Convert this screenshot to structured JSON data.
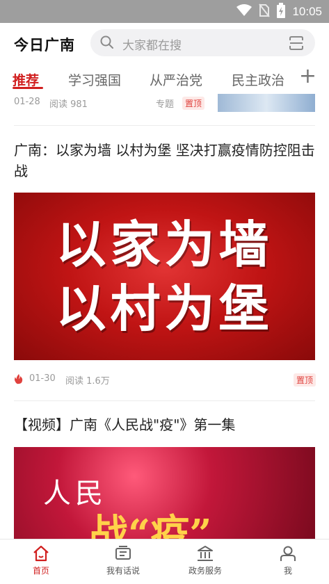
{
  "status_bar": {
    "time": "10:05"
  },
  "header": {
    "app_title": "今日广南",
    "search_placeholder": "大家都在搜"
  },
  "tabs": [
    {
      "label": "推荐",
      "active": true
    },
    {
      "label": "学习强国",
      "active": false
    },
    {
      "label": "从严治党",
      "active": false
    },
    {
      "label": "民主政治",
      "active": false
    }
  ],
  "feed": {
    "partial_item": {
      "date": "01-28",
      "reads": "阅读 981",
      "tag": "专题",
      "pin": "置顶"
    },
    "item1": {
      "title": "广南：以家为墙  以村为堡  坚决打赢疫情防控阻击战",
      "banner_line1": "以家为墙",
      "banner_line2": "以村为堡",
      "date": "01-30",
      "reads": "阅读 1.6万",
      "pin": "置顶"
    },
    "item2": {
      "title": "【视频】广南《人民战\"疫\"》第一集",
      "banner_text1": "人民",
      "banner_text2": "战“疫”"
    }
  },
  "bottom_nav": [
    {
      "label": "首页",
      "icon": "home-icon",
      "active": true
    },
    {
      "label": "我有话说",
      "icon": "chat-icon",
      "active": false
    },
    {
      "label": "政务服务",
      "icon": "building-icon",
      "active": false
    },
    {
      "label": "我",
      "icon": "user-icon",
      "active": false
    }
  ],
  "colors": {
    "accent": "#d11f1f",
    "status_bar": "#9e9e9e"
  }
}
